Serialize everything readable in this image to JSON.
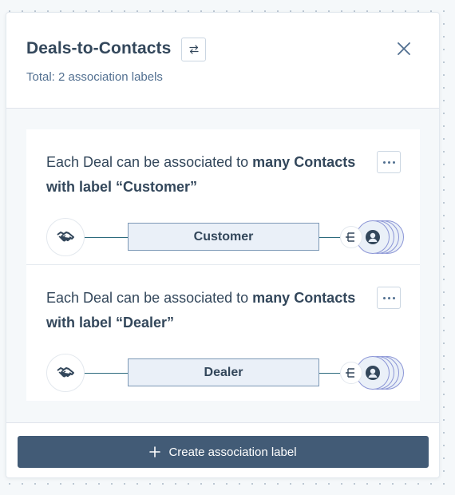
{
  "header": {
    "title": "Deals-to-Contacts",
    "subtitle": "Total: 2 association labels",
    "swap_icon": "swap-arrows-icon",
    "close_icon": "close-icon"
  },
  "labels": [
    {
      "text_prefix": "Each Deal can be associated to ",
      "text_bold": "many Contacts with label “Customer”",
      "label": "Customer",
      "more_icon": "more-options-icon",
      "from_icon": "handshake-icon",
      "to_icon": "contact-person-icon"
    },
    {
      "text_prefix": "Each Deal can be associated to ",
      "text_bold": "many Contacts with label “Dealer”",
      "label": "Dealer",
      "more_icon": "more-options-icon",
      "from_icon": "handshake-icon",
      "to_icon": "contact-person-icon"
    }
  ],
  "footer": {
    "create_label": "Create association label",
    "create_icon": "plus-icon"
  },
  "colors": {
    "primary_button": "#425b76",
    "label_fill": "#eaf0f8",
    "label_border": "#7c98b6",
    "contact_ring": "#8b95d6",
    "connector": "#2d6b7d"
  }
}
